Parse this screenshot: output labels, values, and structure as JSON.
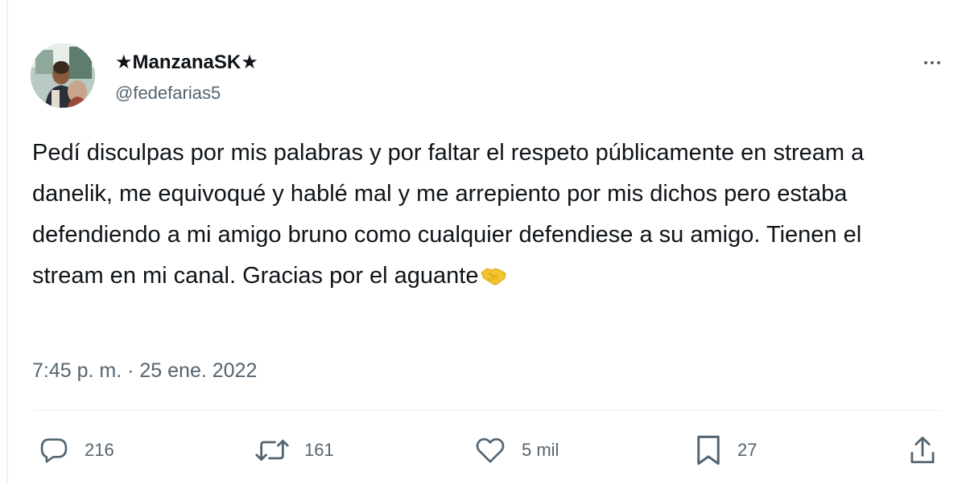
{
  "user": {
    "display_name": "★ManzanaSK★",
    "handle": "@fedefarias5",
    "avatar_icon": "avatar-photo"
  },
  "tweet": {
    "text": "Pedí disculpas por mis palabras y por faltar el respeto públicamente en stream a danelik, me equivoqué y hablé mal y me arrepiento por mis dichos pero estaba defendiendo a mi amigo bruno como cualquier defendiese a su amigo. Tienen el stream en mi canal. Gracias por el aguante",
    "emoji_icon": "handshake-emoji",
    "timestamp": "7:45 p. m. · 25 ene. 2022"
  },
  "actions": {
    "replies": {
      "icon": "reply-icon",
      "count": "216"
    },
    "reposts": {
      "icon": "repost-icon",
      "count": "161"
    },
    "likes": {
      "icon": "like-icon",
      "count": "5 mil"
    },
    "bookmarks": {
      "icon": "bookmark-icon",
      "count": "27"
    },
    "share": {
      "icon": "share-icon"
    }
  },
  "more_icon": "more-dots-icon",
  "colors": {
    "text_primary": "#0f1419",
    "text_secondary": "#536471",
    "divider": "#eff3f4",
    "emoji": "#f5c531"
  }
}
